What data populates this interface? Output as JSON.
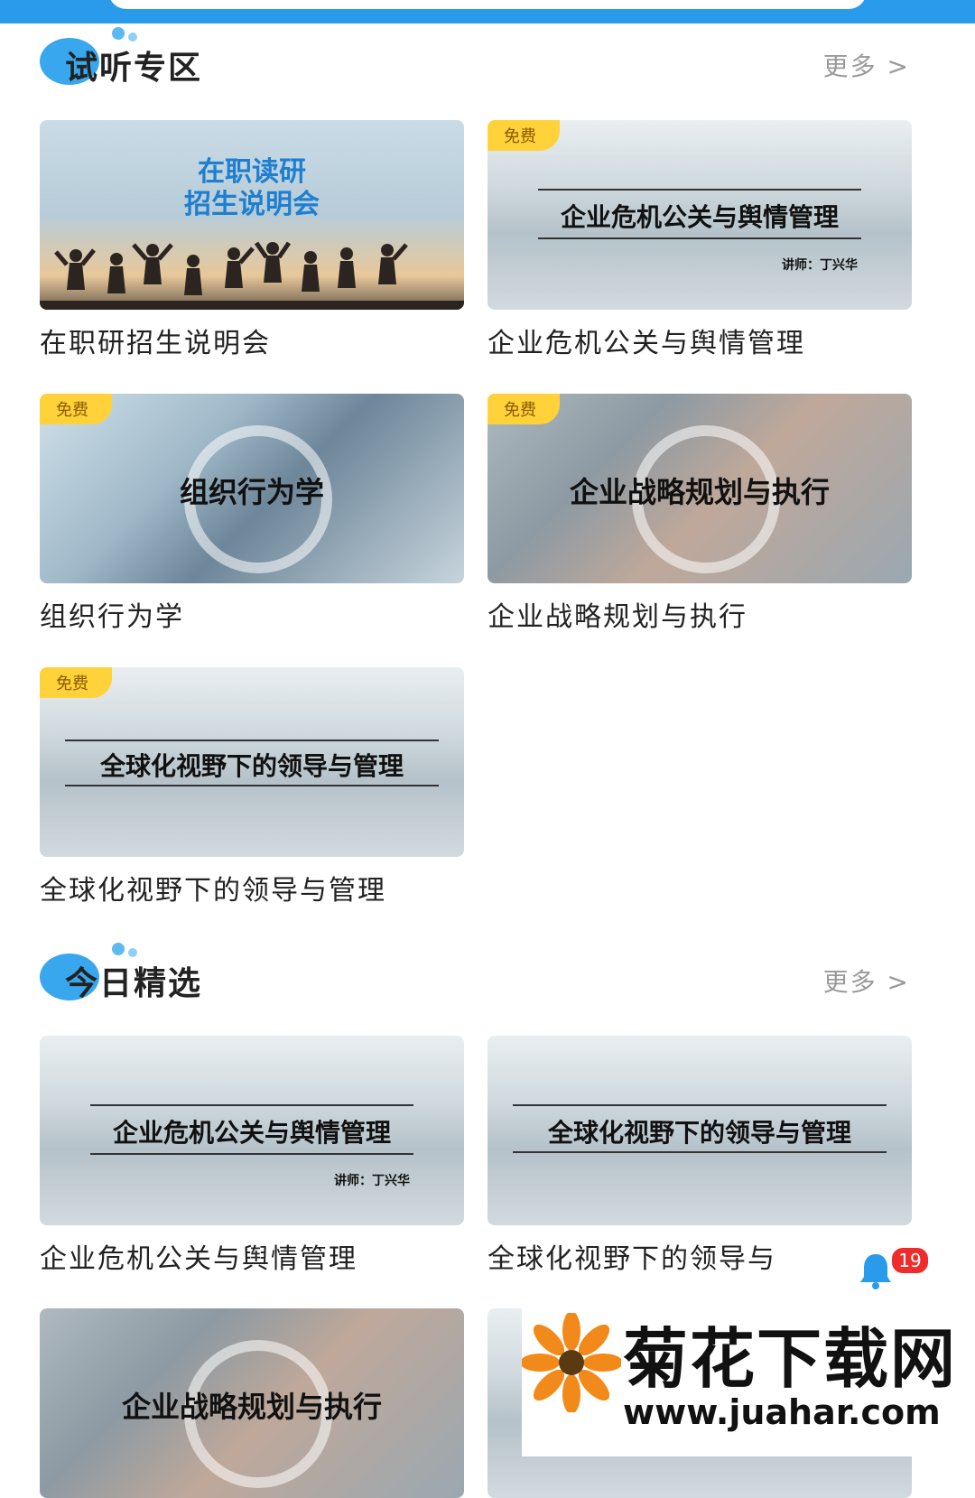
{
  "sections": [
    {
      "title": "试听专区",
      "more": "更多 >",
      "cards": [
        {
          "thumb_title": "在职读研\n招生说明会",
          "caption": "在职研招生说明会",
          "free": ""
        },
        {
          "thumb_title": "企业危机公关与舆情管理",
          "lecturer": "讲师：丁兴华",
          "caption": "企业危机公关与舆情管理",
          "free": "免费"
        },
        {
          "thumb_title": "组织行为学",
          "caption": "组织行为学",
          "free": "免费"
        },
        {
          "thumb_title": "企业战略规划与执行",
          "caption": "企业战略规划与执行",
          "free": "免费"
        },
        {
          "thumb_title": "全球化视野下的领导与管理",
          "caption": "全球化视野下的领导与管理",
          "free": "免费"
        }
      ]
    },
    {
      "title": "今日精选",
      "more": "更多 >",
      "cards": [
        {
          "thumb_title": "企业危机公关与舆情管理",
          "lecturer": "讲师：丁兴华",
          "caption": "企业危机公关与舆情管理"
        },
        {
          "thumb_title": "全球化视野下的领导与管理",
          "caption": "全球化视野下的领导与"
        },
        {
          "thumb_title": "企业战略规划与执行"
        }
      ]
    }
  ],
  "notification": {
    "count": "19"
  },
  "watermark": {
    "title": "菊花下载网",
    "url": "www.juahar.com"
  },
  "colors": {
    "accent": "#2a9bea",
    "free_tag": "#ffd23a",
    "badge": "#ef2b2b"
  }
}
